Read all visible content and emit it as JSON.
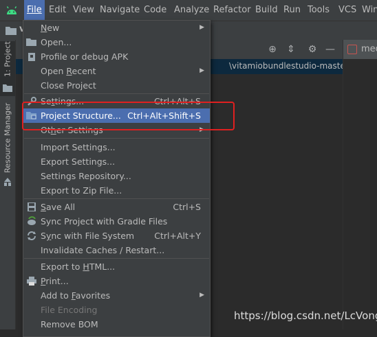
{
  "menubar": {
    "items": [
      {
        "label": "File"
      },
      {
        "label": "Edit"
      },
      {
        "label": "View"
      },
      {
        "label": "Navigate"
      },
      {
        "label": "Code"
      },
      {
        "label": "Analyze"
      },
      {
        "label": "Refactor"
      },
      {
        "label": "Build"
      },
      {
        "label": "Run"
      },
      {
        "label": "Tools"
      },
      {
        "label": "VCS"
      },
      {
        "label": "Win"
      }
    ],
    "active_index": 0,
    "icon": "android-icon"
  },
  "navbar": {
    "text": "v"
  },
  "left_strip": {
    "project_tab": "1: Project",
    "resource_tab": "Resource Manager"
  },
  "project_panel": {
    "path_text": "\\vitamiobundlestudio-master\\vita"
  },
  "editor": {
    "tab_label": "med"
  },
  "file_menu": {
    "items": [
      {
        "label": "New",
        "underline": "N",
        "shortcut": "",
        "submenu": true,
        "icon": ""
      },
      {
        "label": "Open...",
        "underline": "",
        "shortcut": "",
        "submenu": false,
        "icon": "folder-open-icon"
      },
      {
        "label": "Profile or debug APK",
        "underline": "",
        "shortcut": "",
        "submenu": false,
        "icon": "apk-icon"
      },
      {
        "label": "Open Recent",
        "underline": "R",
        "shortcut": "",
        "submenu": true,
        "icon": ""
      },
      {
        "label": "Close Project",
        "underline": "",
        "shortcut": "",
        "submenu": false,
        "icon": ""
      },
      {
        "label": "Settings...",
        "underline": "t",
        "shortcut": "Ctrl+Alt+S",
        "submenu": false,
        "icon": "wrench-icon"
      },
      {
        "label": "Project Structure...",
        "underline": "",
        "shortcut": "Ctrl+Alt+Shift+S",
        "submenu": false,
        "icon": "project-structure-icon"
      },
      {
        "label": "Other Settings",
        "underline": "h",
        "shortcut": "",
        "submenu": true,
        "icon": ""
      },
      {
        "label": "Import Settings...",
        "underline": "",
        "shortcut": "",
        "submenu": false,
        "icon": ""
      },
      {
        "label": "Export Settings...",
        "underline": "",
        "shortcut": "",
        "submenu": false,
        "icon": ""
      },
      {
        "label": "Settings Repository...",
        "underline": "",
        "shortcut": "",
        "submenu": false,
        "icon": ""
      },
      {
        "label": "Export to Zip File...",
        "underline": "",
        "shortcut": "",
        "submenu": false,
        "icon": ""
      },
      {
        "label": "Save All",
        "underline": "S",
        "shortcut": "Ctrl+S",
        "submenu": false,
        "icon": "save-icon"
      },
      {
        "label": "Sync Project with Gradle Files",
        "underline": "",
        "shortcut": "",
        "submenu": false,
        "icon": "gradle-sync-icon"
      },
      {
        "label": "Sync with File System",
        "underline": "y",
        "shortcut": "Ctrl+Alt+Y",
        "submenu": false,
        "icon": "refresh-icon"
      },
      {
        "label": "Invalidate Caches / Restart...",
        "underline": "",
        "shortcut": "",
        "submenu": false,
        "icon": ""
      },
      {
        "label": "Export to HTML...",
        "underline": "H",
        "shortcut": "",
        "submenu": false,
        "icon": ""
      },
      {
        "label": "Print...",
        "underline": "P",
        "shortcut": "",
        "submenu": false,
        "icon": "print-icon"
      },
      {
        "label": "Add to Favorites",
        "underline": "F",
        "shortcut": "",
        "submenu": true,
        "icon": ""
      },
      {
        "label": "File Encoding",
        "underline": "",
        "shortcut": "",
        "submenu": false,
        "icon": "",
        "disabled": true
      },
      {
        "label": "Remove BOM",
        "underline": "",
        "shortcut": "",
        "submenu": false,
        "icon": ""
      }
    ],
    "selected_index": 6
  },
  "watermark": "https://blog.csdn.net/LcVong",
  "colors": {
    "selection": "#4b6eaf",
    "highlight_box": "#e02020",
    "menu_bg": "#3c3f41"
  }
}
